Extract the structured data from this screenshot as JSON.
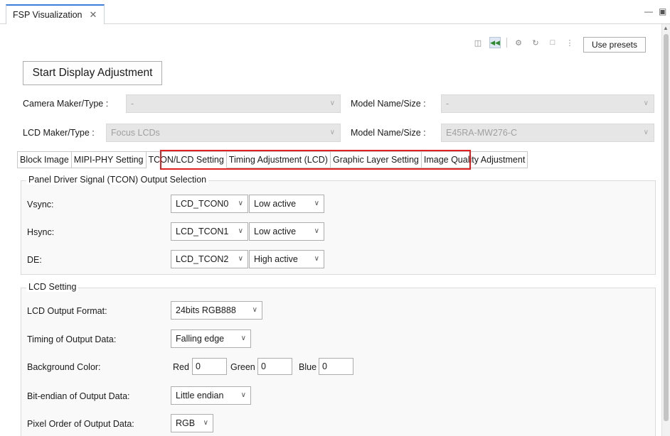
{
  "view": {
    "tab_title": "FSP Visualization",
    "close_glyph": "✕",
    "minimize_glyph": "▭",
    "maximize_glyph": "▢"
  },
  "toolbar": {
    "icons": [
      "monitor-icon",
      "rewind-icon",
      "filter-icon",
      "refresh-icon",
      "layout-icon",
      "more-icon"
    ],
    "use_presets": "Use presets",
    "start_adjustment": "Start Display Adjustment"
  },
  "camera": {
    "maker_label": "Camera Maker/Type :",
    "maker_value": "-",
    "model_label": "Model Name/Size :",
    "model_value": "-"
  },
  "lcd": {
    "maker_label": "LCD Maker/Type :",
    "maker_value": "Focus LCDs",
    "model_label": "Model Name/Size :",
    "model_value": "E45RA-MW276-C"
  },
  "tabs": [
    {
      "label": "Block Image"
    },
    {
      "label": "MIPI-PHY Setting"
    },
    {
      "label": "TCON/LCD Setting"
    },
    {
      "label": "Timing Adjustment (LCD)"
    },
    {
      "label": "Graphic Layer Setting"
    },
    {
      "label": "Image Quality Adjustment"
    }
  ],
  "selected_tab": "TCON/LCD Setting",
  "highlight_color": "#e02020",
  "tcon_group": {
    "title": "Panel Driver Signal (TCON) Output Selection",
    "rows": [
      {
        "label": "Vsync:",
        "signal": "LCD_TCON0",
        "polarity": "Low active"
      },
      {
        "label": "Hsync:",
        "signal": "LCD_TCON1",
        "polarity": "Low active"
      },
      {
        "label": "DE:",
        "signal": "LCD_TCON2",
        "polarity": "High active"
      }
    ]
  },
  "lcd_group": {
    "title": "LCD Setting",
    "output_format_label": "LCD Output Format:",
    "output_format_value": "24bits RGB888",
    "timing_label": "Timing of Output Data:",
    "timing_value": "Falling edge",
    "bg_label": "Background Color:",
    "red_label": "Red",
    "red_value": "0",
    "green_label": "Green",
    "green_value": "0",
    "blue_label": "Blue",
    "blue_value": "0",
    "endian_label": "Bit-endian of Output Data:",
    "endian_value": "Little endian",
    "pixel_order_label": "Pixel Order of Output Data:",
    "pixel_order_value": "RGB"
  }
}
